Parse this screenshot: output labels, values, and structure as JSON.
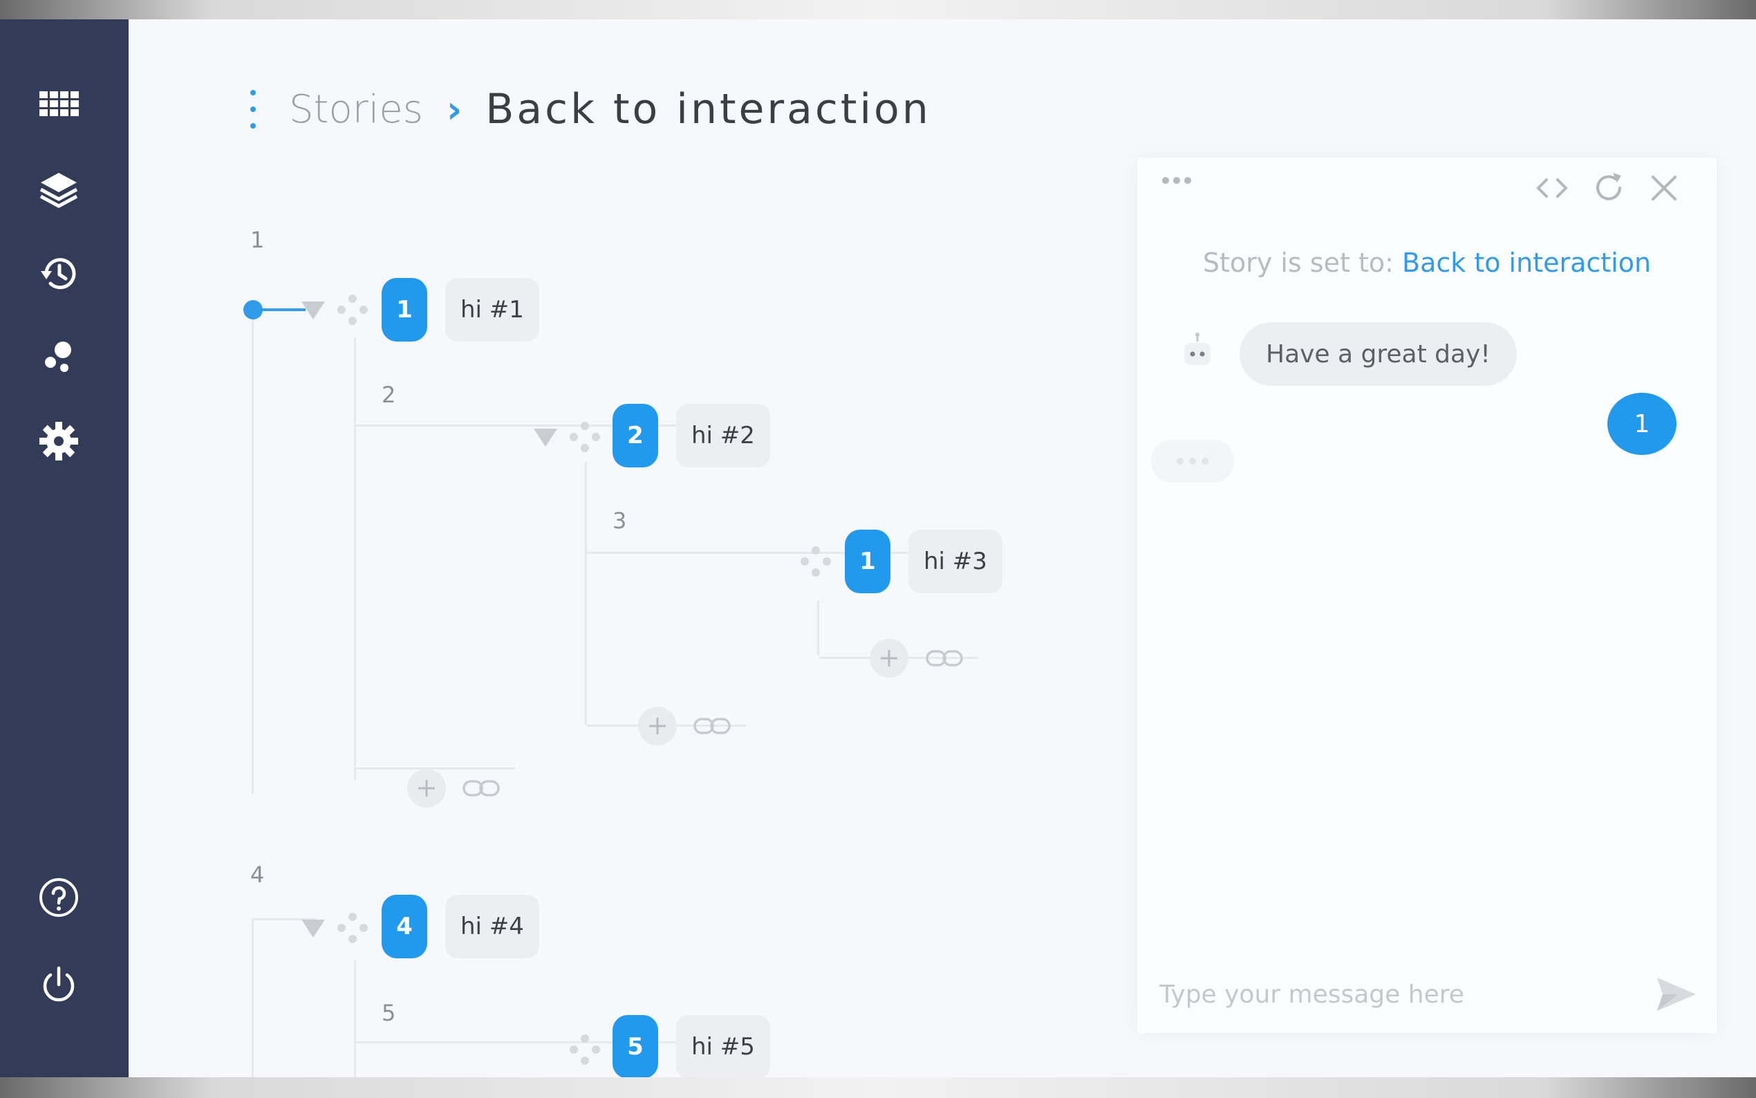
{
  "breadcrumb": {
    "parent": "Stories",
    "separator": "›",
    "current": "Back to interaction"
  },
  "sidebar": {
    "items": [
      {
        "name": "apps",
        "icon": "grid-icon"
      },
      {
        "name": "layers",
        "icon": "layers-icon"
      },
      {
        "name": "history",
        "icon": "history-icon"
      },
      {
        "name": "analytics",
        "icon": "bubbles-icon"
      },
      {
        "name": "settings",
        "icon": "gear-icon"
      }
    ],
    "bottom_items": [
      {
        "name": "help",
        "icon": "help-icon"
      },
      {
        "name": "logout",
        "icon": "power-icon"
      }
    ]
  },
  "tree": {
    "nodes": [
      {
        "depth_label": "1",
        "badge": "1",
        "text": "hi #1"
      },
      {
        "depth_label": "2",
        "badge": "2",
        "text": "hi #2"
      },
      {
        "depth_label": "3",
        "badge": "1",
        "text": "hi #3"
      },
      {
        "depth_label": "4",
        "badge": "4",
        "text": "hi #4"
      },
      {
        "depth_label": "5",
        "badge": "5",
        "text": "hi #5"
      }
    ]
  },
  "chat": {
    "story_set_prefix": "Story is set to: ",
    "story_set_link": "Back to interaction",
    "bot_message": "Have a great day!",
    "user_message": "1",
    "input_placeholder": "Type your message here"
  },
  "colors": {
    "sidebar": "#323b57",
    "accent": "#2199ec",
    "pill": "#eceef1"
  }
}
